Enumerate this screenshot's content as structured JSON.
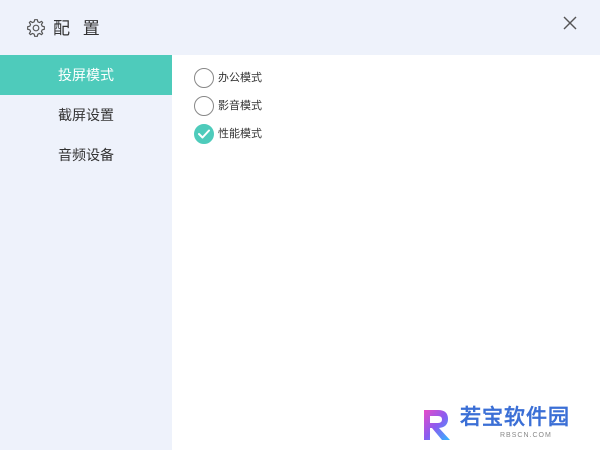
{
  "title": "配 置",
  "sidebar": {
    "items": [
      {
        "label": "投屏模式",
        "active": true
      },
      {
        "label": "截屏设置",
        "active": false
      },
      {
        "label": "音频设备",
        "active": false
      }
    ]
  },
  "options": [
    {
      "label": "办公模式",
      "checked": false
    },
    {
      "label": "影音模式",
      "checked": false
    },
    {
      "label": "性能模式",
      "checked": true
    }
  ],
  "watermark": {
    "logo_letter": "R",
    "text": "若宝软件园",
    "subtext": "RBSCN.COM"
  },
  "colors": {
    "accent": "#4ecbbb",
    "panel_bg": "#eef2fb",
    "content_bg": "#ffffff"
  },
  "icons": {
    "title": "gear-icon",
    "close": "close-icon",
    "checked_option": "check-icon"
  }
}
